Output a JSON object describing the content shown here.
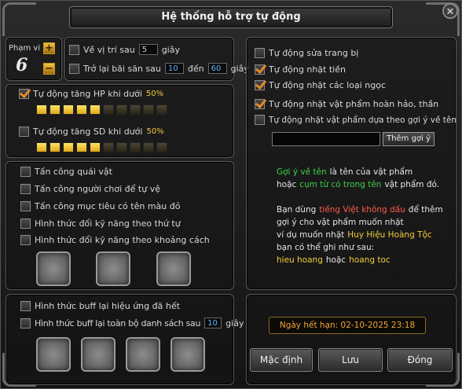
{
  "window": {
    "title": "Hệ thống hỗ trợ tự động",
    "close_label": "✕"
  },
  "range": {
    "label": "Phạm vi",
    "value": "6",
    "plus": "+",
    "minus": "−",
    "return_label": "Về vị trí sau",
    "return_value": "5",
    "return_unit": "giây",
    "back_label": "Trở lại bãi săn sau",
    "back_from": "10",
    "back_to_label": "đến",
    "back_to": "60",
    "back_unit": "giây"
  },
  "hp": {
    "label": "Tự động tăng HP khi dưới",
    "percent": "50%",
    "checked": true,
    "level": 0.5
  },
  "sd": {
    "label": "Tự động tăng SD khi dưới",
    "percent": "50%",
    "checked": false,
    "level": 0.5
  },
  "combat": [
    "Tấn công quái vật",
    "Tấn công người chơi để tự vệ",
    "Tấn công mục tiêu có tên màu đỏ",
    "Hình thức đổi kỹ năng theo thứ tự",
    "Hình thức đổi kỹ năng theo khoảng cách"
  ],
  "buff": {
    "effect_label": "Hình thức buff lại hiệu ứng đã hết",
    "list_label": "Hình thức buff lại toàn bộ danh sách sau",
    "list_value": "10",
    "list_unit": "giây"
  },
  "pickup": {
    "items": [
      {
        "label": "Tự động sửa trang bị",
        "checked": false
      },
      {
        "label": "Tự động nhặt tiền",
        "checked": true
      },
      {
        "label": "Tự động nhặt các loại ngọc",
        "checked": true
      },
      {
        "label": "Tự động nhặt vật phẩm hoàn hảo, thần",
        "checked": true
      },
      {
        "label": "Tự động nhặt vật phẩm dựa theo gợi ý về tên",
        "checked": false
      }
    ],
    "add_button": "Thêm gợi ý",
    "input_value": ""
  },
  "info": {
    "l1a": "Gợi ý về tên",
    "l1b": "là tên của vật phẩm",
    "l2a": "hoặc",
    "l2b": "cụm từ có trong tên",
    "l2c": "vật phẩm đó.",
    "l3a": "Bạn dùng",
    "l3b": "tiếng Việt không dấu",
    "l3c": "để thêm",
    "l4": "gợi ý cho vật phẩm muốn nhặt",
    "l5a": "ví dụ muốn nhặt",
    "l5b": "Huy Hiệu Hoàng Tộc",
    "l6": "bạn có thể ghi như sau:",
    "l7a": "hieu hoang",
    "l7b": "hoặc",
    "l7c": "hoang toc"
  },
  "expiry": "Ngày hết hạn: 02-10-2025  23:18",
  "buttons": {
    "default": "Mặc định",
    "save": "Lưu",
    "close": "Đóng"
  },
  "colors": {
    "accent": "#f2cd3a",
    "checkmark": "#e08a2a",
    "info_green": "#3fd04a",
    "info_red": "#ff5a4a"
  }
}
